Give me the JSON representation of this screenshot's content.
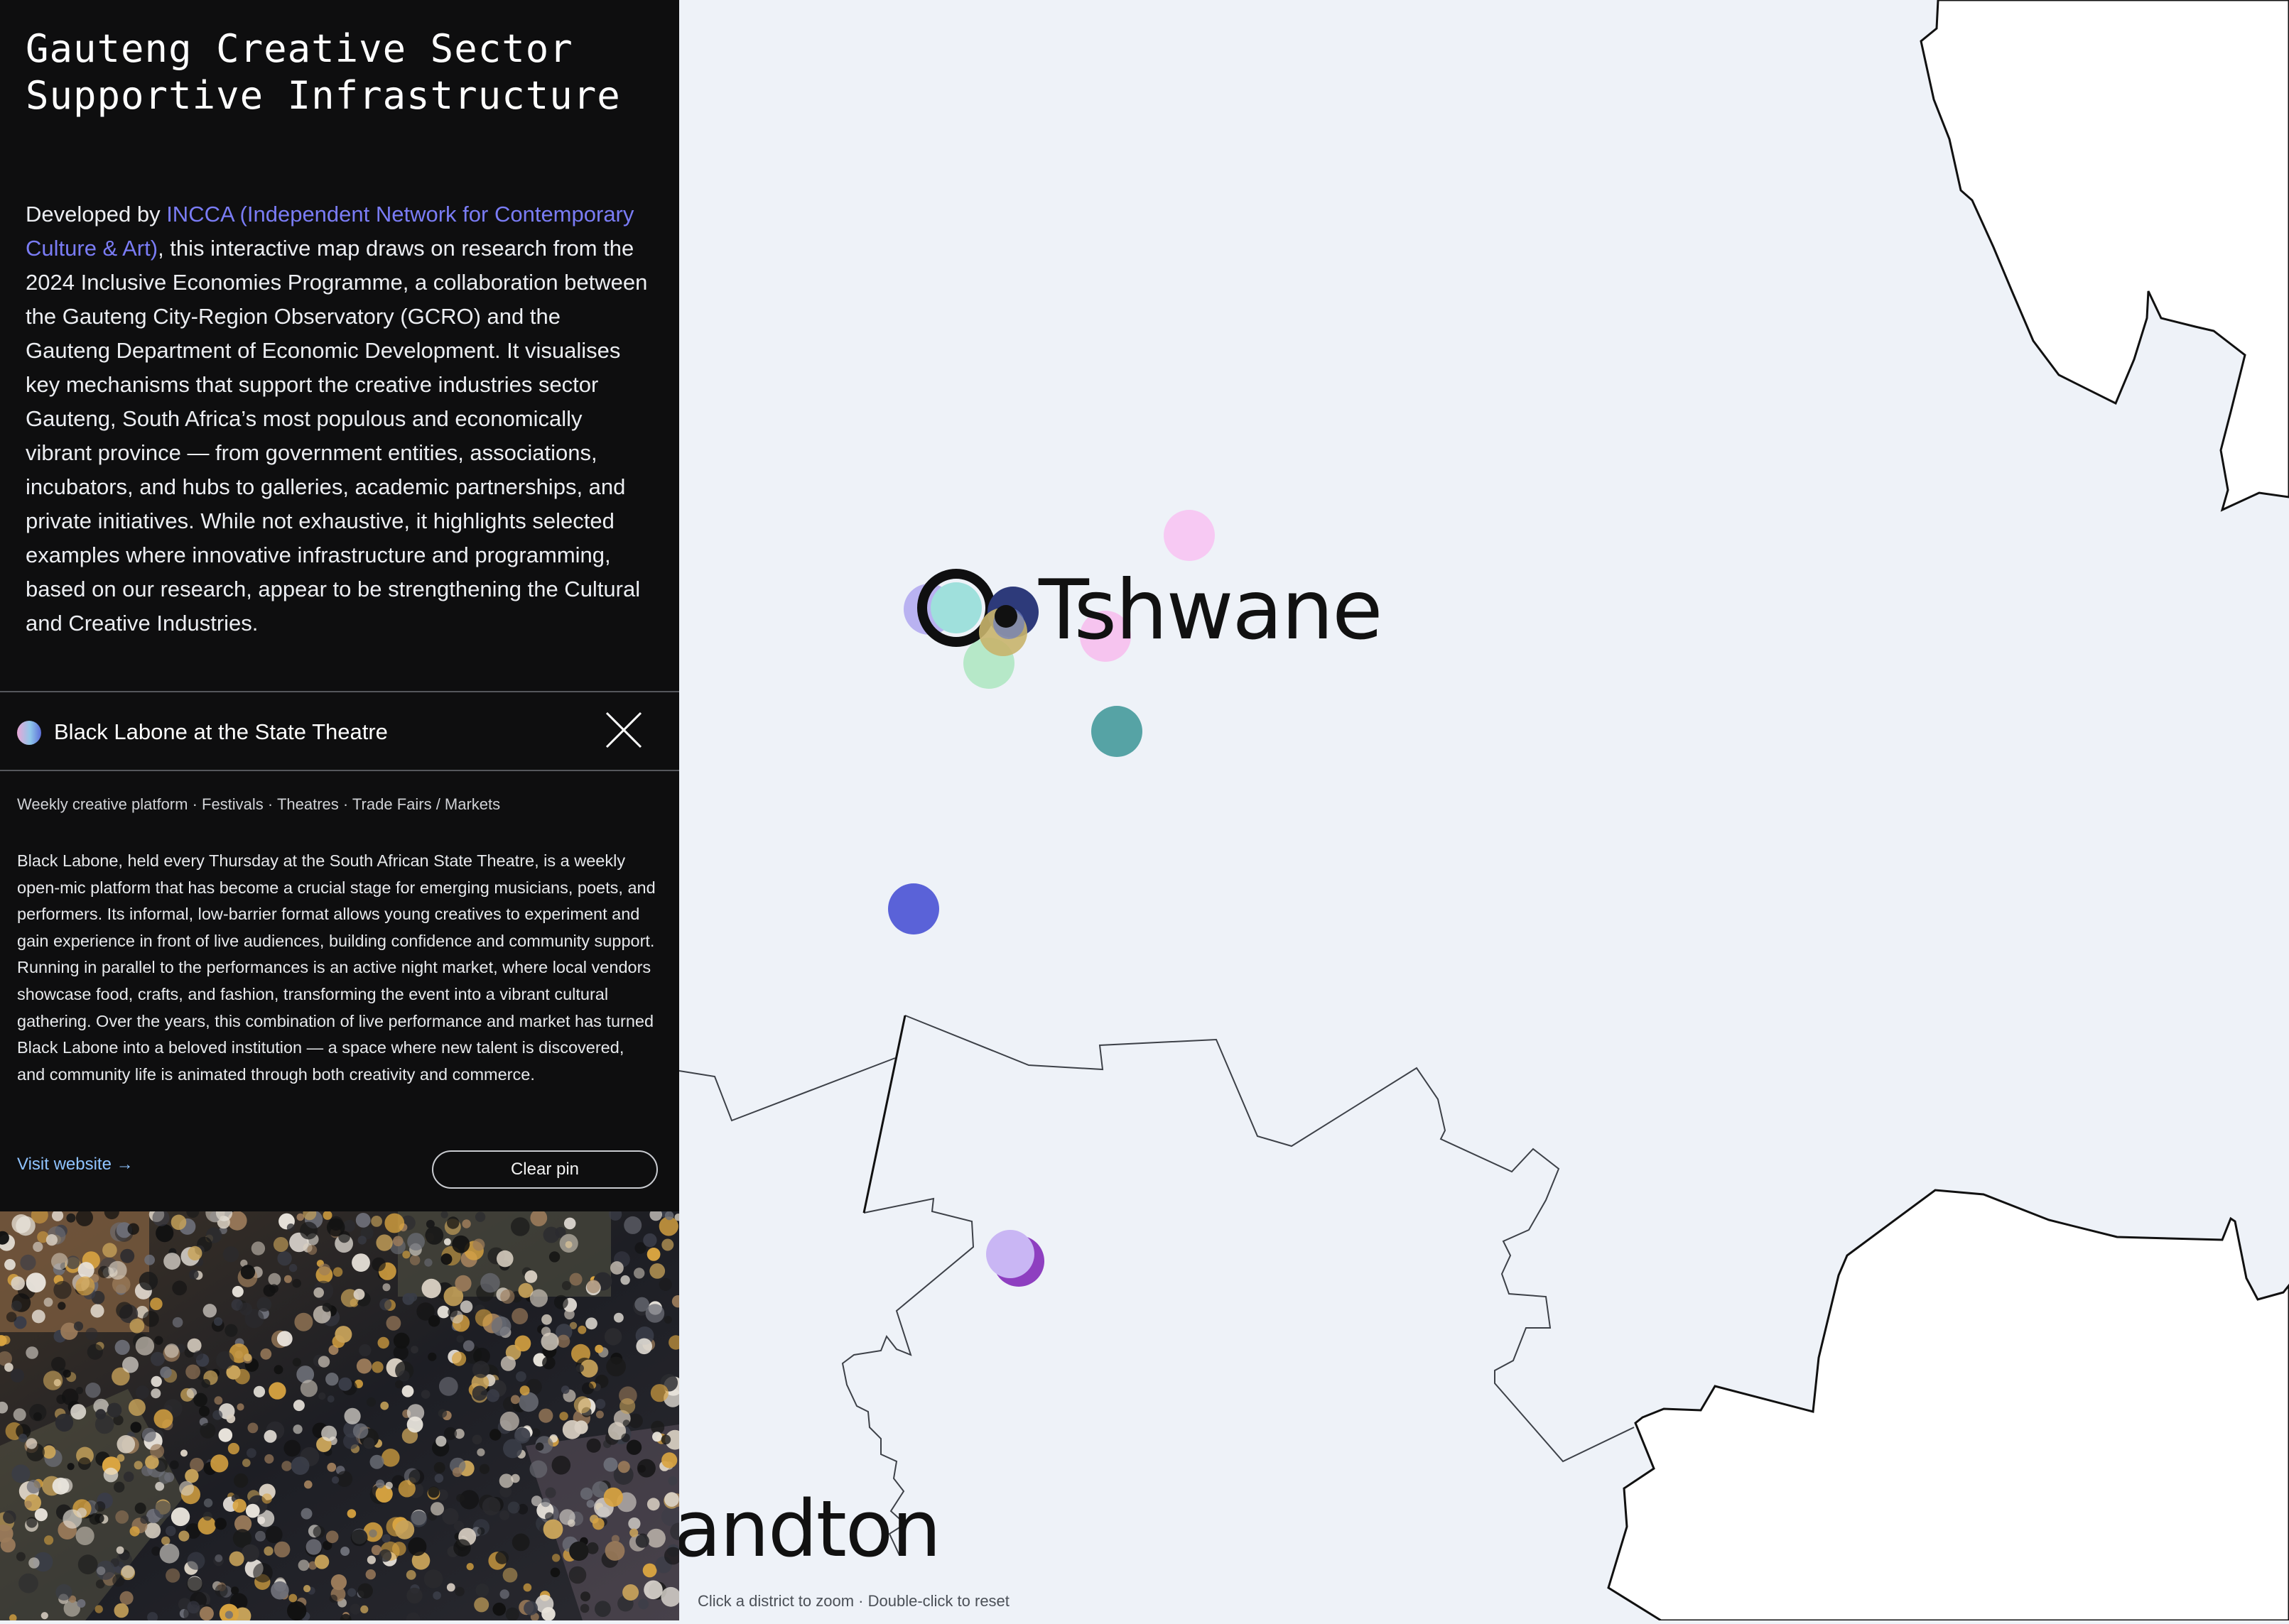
{
  "sidebar": {
    "title_line1": "Gauteng Creative Sector",
    "title_line2": "Supportive Infrastructure",
    "intro": {
      "prefix": "Developed by ",
      "link_text": "INCCA (Independent Network for Contemporary Culture & Art)",
      "body": ", this interactive map draws on research from the 2024 Inclusive Economies Programme, a collaboration between the Gauteng City-Region Observatory (GCRO) and the Gauteng Department of Economic Development. It visualises key mechanisms that support the creative industries sector Gauteng, South Africa’s most populous and economically vibrant province — from government entities, associations, incubators, and hubs to galleries, academic partnerships, and private initiatives. While not exhaustive, it highlights selected examples where innovative infrastructure and programming, based on our research, appear to be strengthening the Cultural and Creative Industries."
    }
  },
  "selected_pin": {
    "title": "Black Labone at the State Theatre",
    "tags": "Weekly creative platform · Festivals · Theatres · Trade Fairs / Markets",
    "description": "Black Labone, held every Thursday at the South African State Theatre, is a weekly open-mic platform that has become a crucial stage for emerging musicians, poets, and performers. Its informal, low-barrier format allows young creatives to experiment and gain experience in front of live audiences, building confidence and community support. Running in parallel to the performances is an active night market, where local vendors showcase food, crafts, and fashion, transforming the event into a vibrant cultural gathering. Over the years, this combination of live performance and market has turned Black Labone into a beloved institution — a space where new talent is discovered, and community life is animated through both creativity and commerce.",
    "visit_label": "Visit website →",
    "clear_label": "Clear pin",
    "close_icon": "close-icon"
  },
  "map": {
    "labels": {
      "tshwane": "Tshwane",
      "sandton": "Sandton"
    },
    "hint": "Click a district to zoom · Double-click to reset",
    "colors": {
      "background": "#eef2f8",
      "outside": "#ffffff",
      "border": "#111111"
    }
  }
}
